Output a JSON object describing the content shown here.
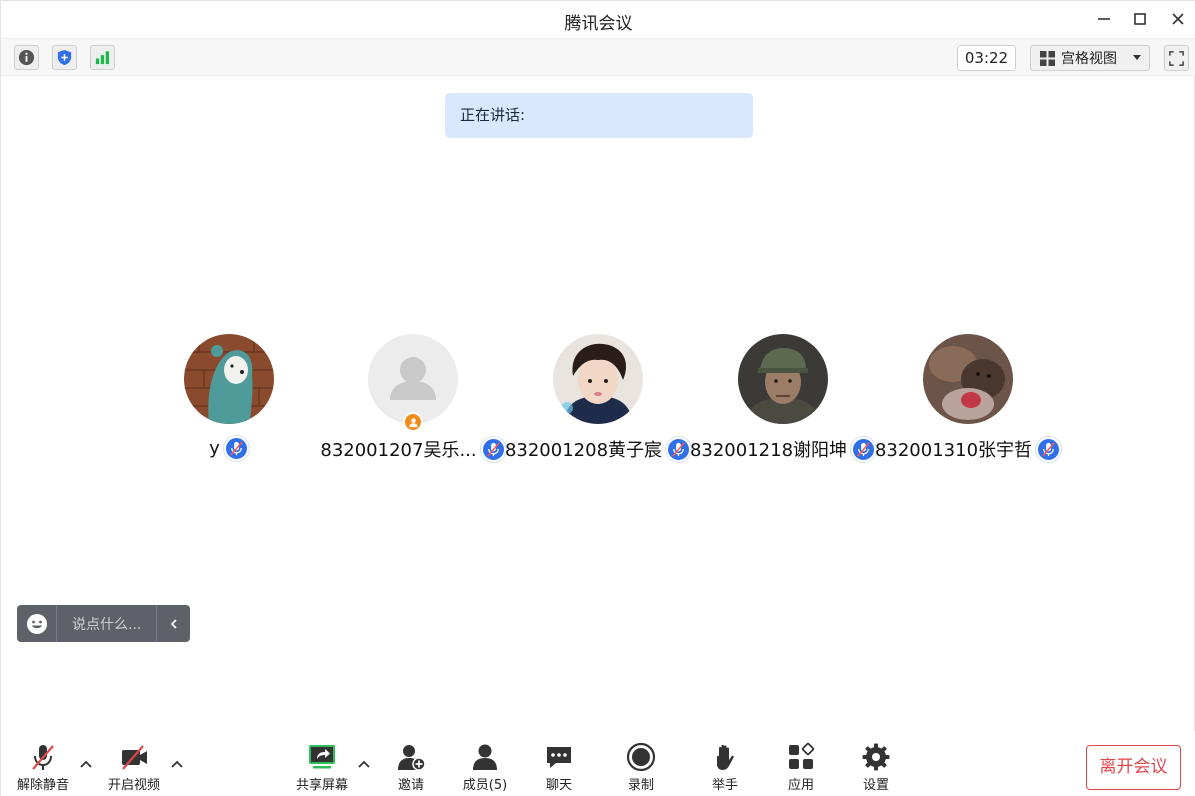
{
  "window": {
    "title": "腾讯会议"
  },
  "toolbar": {
    "timer": "03:22",
    "view_mode": "宫格视图"
  },
  "speaking": {
    "label": "正在讲话:"
  },
  "participants": [
    {
      "name": "y",
      "avatar": "teal-hoodie-bear",
      "host": false,
      "muted": true
    },
    {
      "name": "832001207吴乐...",
      "avatar": "default-person",
      "host": true,
      "muted": true
    },
    {
      "name": "832001208黄子宸",
      "avatar": "photo-young-man",
      "host": false,
      "muted": true
    },
    {
      "name": "832001218谢阳坤",
      "avatar": "photo-man-cap",
      "host": false,
      "muted": true
    },
    {
      "name": "832001310张宇哲",
      "avatar": "photo-animals",
      "host": false,
      "muted": true
    }
  ],
  "chat": {
    "placeholder": "说点什么..."
  },
  "bottom": {
    "unmute": "解除静音",
    "video": "开启视频",
    "share": "共享屏幕",
    "invite": "邀请",
    "members": "成员(5)",
    "chat": "聊天",
    "record": "录制",
    "raise_hand": "举手",
    "apps": "应用",
    "settings": "设置",
    "leave": "离开会议"
  },
  "colors": {
    "accent_blue": "#2f6fe8",
    "danger_red": "#e0474c",
    "host_orange": "#f38b1b",
    "signal_green": "#1fb84b",
    "share_green": "#2dbd5a"
  }
}
